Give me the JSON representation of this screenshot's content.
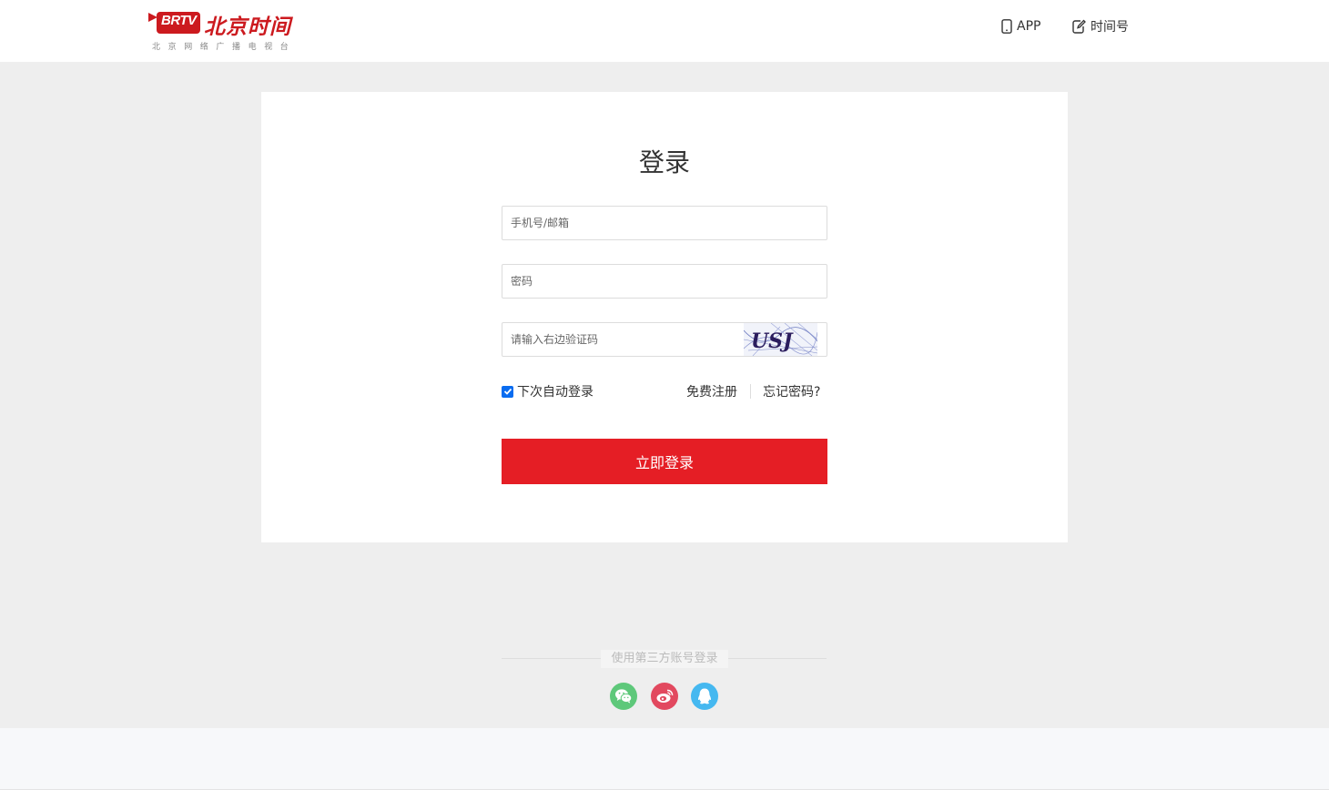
{
  "header": {
    "logo_badge": "BRTV",
    "logo_name": "北京时间",
    "logo_subtitle": "北京网络广播电视台",
    "nav": {
      "app_label": "APP",
      "shijianhao_label": "时间号"
    }
  },
  "login": {
    "title": "登录",
    "username_placeholder": "手机号/邮箱",
    "password_placeholder": "密码",
    "captcha_placeholder": "请输入右边验证码",
    "captcha_text": "USJ",
    "remember_label": "下次自动登录",
    "remember_checked": true,
    "register_label": "免费注册",
    "forgot_label": "忘记密码?",
    "submit_label": "立即登录"
  },
  "third_party": {
    "label": "使用第三方账号登录",
    "providers": [
      {
        "name": "wechat",
        "icon": "wechat-icon",
        "color": "#5ec87a"
      },
      {
        "name": "weibo",
        "icon": "weibo-icon",
        "color": "#e2495f"
      },
      {
        "name": "qq",
        "icon": "qq-icon",
        "color": "#45b8f0"
      }
    ]
  },
  "colors": {
    "brand_red": "#cc1a1f",
    "button_red": "#e51e25",
    "checkbox_blue": "#0a6cf0",
    "page_bg": "#eeeeee"
  }
}
